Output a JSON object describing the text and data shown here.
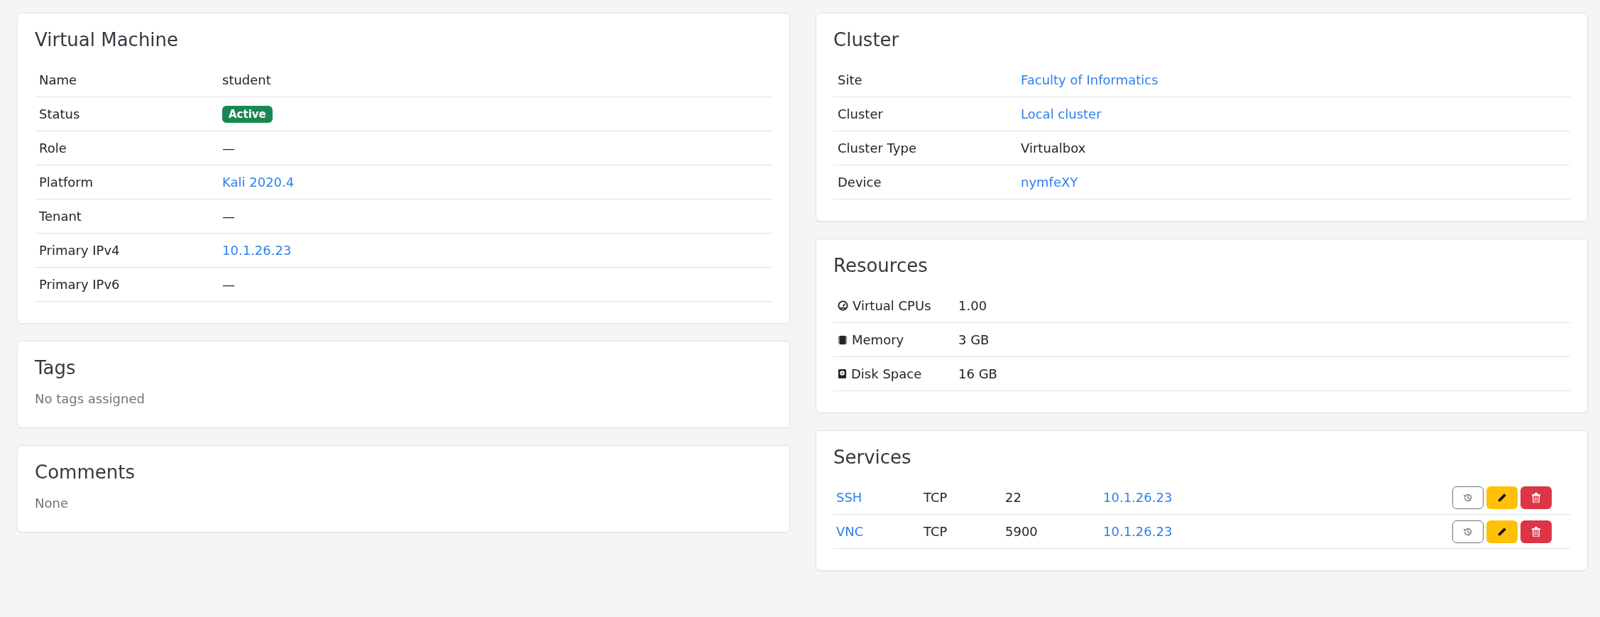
{
  "virtual_machine": {
    "title": "Virtual Machine",
    "rows": [
      {
        "label": "Name",
        "value": "student",
        "kind": "text"
      },
      {
        "label": "Status",
        "value": "Active",
        "kind": "badge"
      },
      {
        "label": "Role",
        "value": "—",
        "kind": "text"
      },
      {
        "label": "Platform",
        "value": "Kali 2020.4",
        "kind": "link"
      },
      {
        "label": "Tenant",
        "value": "—",
        "kind": "text"
      },
      {
        "label": "Primary IPv4",
        "value": "10.1.26.23",
        "kind": "link"
      },
      {
        "label": "Primary IPv6",
        "value": "—",
        "kind": "text"
      }
    ]
  },
  "tags": {
    "title": "Tags",
    "text": "No tags assigned"
  },
  "comments": {
    "title": "Comments",
    "text": "None"
  },
  "cluster": {
    "title": "Cluster",
    "rows": [
      {
        "label": "Site",
        "value": "Faculty of Informatics",
        "kind": "link"
      },
      {
        "label": "Cluster",
        "value": "Local cluster",
        "kind": "link"
      },
      {
        "label": "Cluster Type",
        "value": "Virtualbox",
        "kind": "text"
      },
      {
        "label": "Device",
        "value": "nymfeXY",
        "kind": "link"
      }
    ]
  },
  "resources": {
    "title": "Resources",
    "rows": [
      {
        "label": "Virtual CPUs",
        "value": "1.00",
        "kind": "text"
      },
      {
        "label": "Memory",
        "value": "3 GB",
        "kind": "text"
      },
      {
        "label": "Disk Space",
        "value": "16 GB",
        "kind": "text"
      }
    ]
  },
  "services": {
    "title": "Services",
    "rows": [
      {
        "name": "SSH",
        "protocol": "TCP",
        "port": "22",
        "address": "10.1.26.23"
      },
      {
        "name": "VNC",
        "protocol": "TCP",
        "port": "5900",
        "address": "10.1.26.23"
      }
    ]
  }
}
